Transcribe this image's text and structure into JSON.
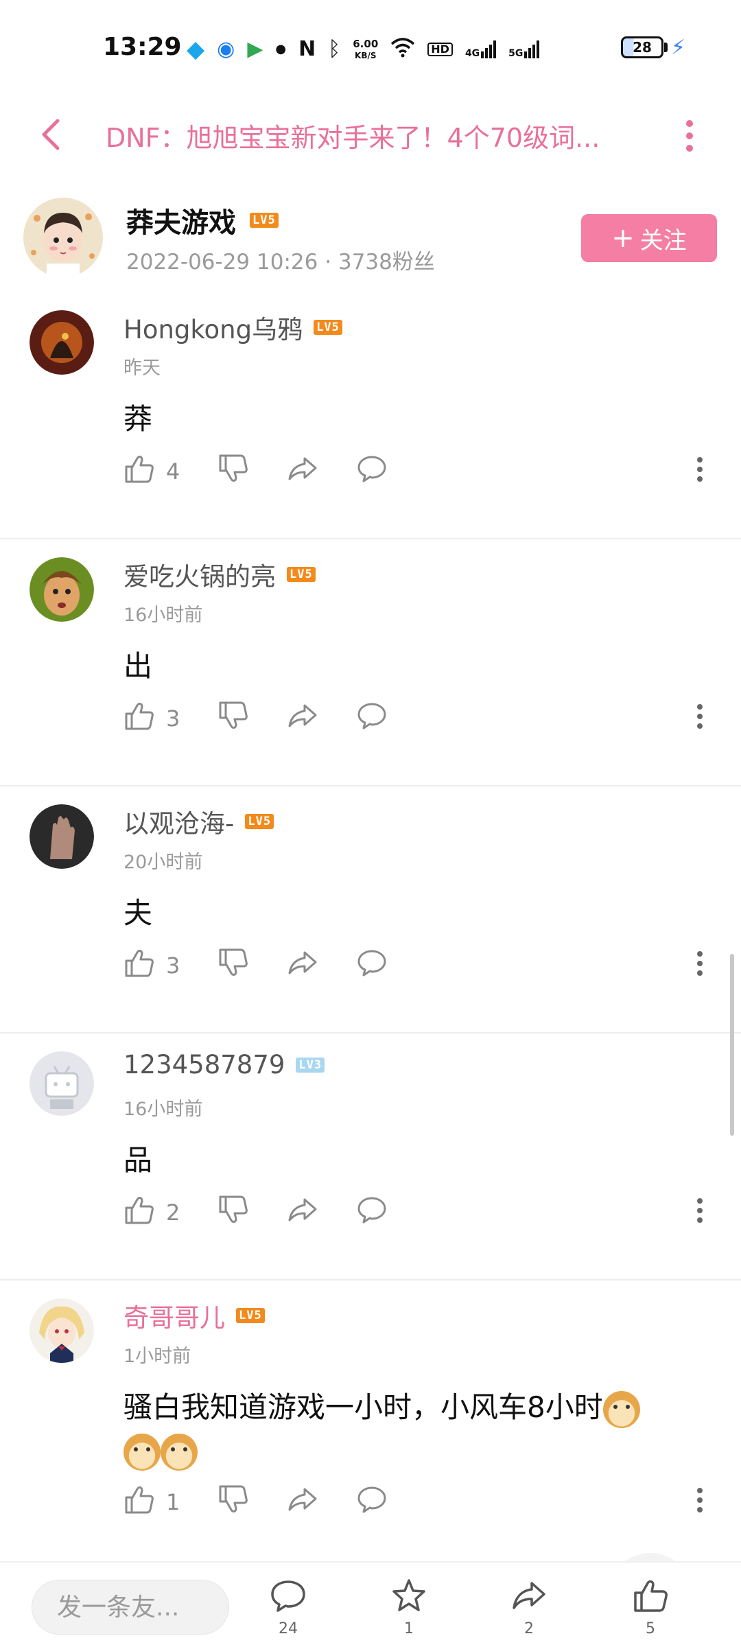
{
  "status_bar": {
    "time": "13:29",
    "net_speed_value": "6.00",
    "net_speed_unit": "KB/S",
    "hd_label": "HD",
    "signal1_label": "4G",
    "signal2_label": "5G",
    "battery": "28"
  },
  "header": {
    "title": "DNF：旭旭宝宝新对手来了！4个70级词..."
  },
  "author": {
    "name": "莽夫游戏",
    "level": "LV5",
    "meta": "2022-06-29 10:26 · 3738粉丝",
    "follow_label": "关注",
    "follow_plus": "+"
  },
  "comments": [
    {
      "name": "Hongkong乌鸦",
      "level": "LV5",
      "time": "昨天",
      "text": "莽",
      "likes": "4"
    },
    {
      "name": "爱吃火锅的亮",
      "level": "LV5",
      "time": "16小时前",
      "text": "出",
      "likes": "3"
    },
    {
      "name": "以观沧海-",
      "level": "LV5",
      "time": "20小时前",
      "text": "夫",
      "likes": "3"
    },
    {
      "name": "1234587879",
      "level": "LV3",
      "time": "16小时前",
      "text": "品",
      "likes": "2"
    },
    {
      "name": "奇哥哥儿",
      "level": "LV5",
      "time": "1小时前",
      "text": "骚白我知道游戏一小时，小风车8小时",
      "likes": "1"
    }
  ],
  "bottom_bar": {
    "reply_placeholder": "发一条友...",
    "comment_count": "24",
    "favorite_count": "1",
    "share_count": "2",
    "like_count": "5"
  },
  "colors": {
    "accent_pink": "#e8709a",
    "follow_button": "#f47ea4",
    "level_badge": "#f28b1c"
  }
}
